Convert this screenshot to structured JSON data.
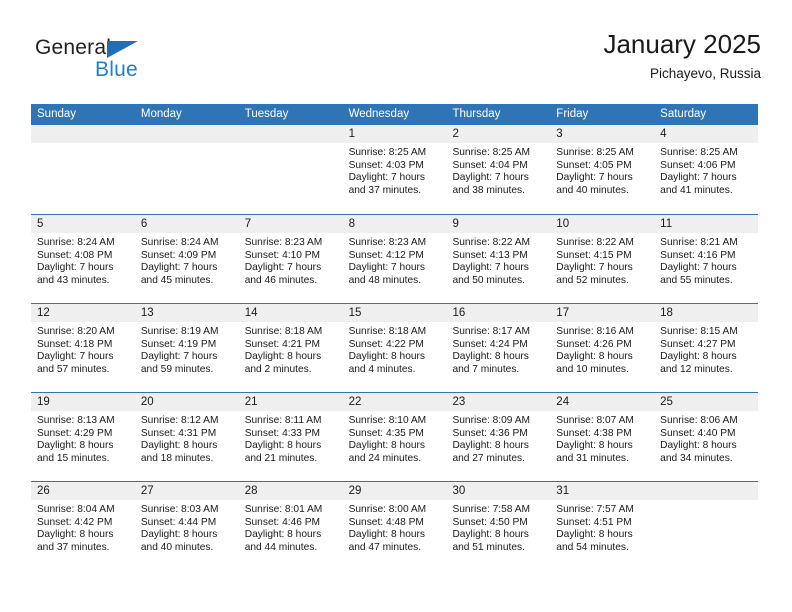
{
  "brand": {
    "name_part1": "General",
    "name_part2": "Blue",
    "triangle_color": "#1f6fb6",
    "blue_text_color": "#1f7fd0"
  },
  "header": {
    "title": "January 2025",
    "subtitle": "Pichayevo, Russia",
    "header_bg_color": "#2f75b5",
    "day_band_color": "#efefef"
  },
  "weekdays": [
    "Sunday",
    "Monday",
    "Tuesday",
    "Wednesday",
    "Thursday",
    "Friday",
    "Saturday"
  ],
  "weeks": [
    [
      {
        "day": "",
        "sunrise": "",
        "sunset": "",
        "daylight_line1": "",
        "daylight_line2": ""
      },
      {
        "day": "",
        "sunrise": "",
        "sunset": "",
        "daylight_line1": "",
        "daylight_line2": ""
      },
      {
        "day": "",
        "sunrise": "",
        "sunset": "",
        "daylight_line1": "",
        "daylight_line2": ""
      },
      {
        "day": "1",
        "sunrise": "Sunrise: 8:25 AM",
        "sunset": "Sunset: 4:03 PM",
        "daylight_line1": "Daylight: 7 hours",
        "daylight_line2": "and 37 minutes."
      },
      {
        "day": "2",
        "sunrise": "Sunrise: 8:25 AM",
        "sunset": "Sunset: 4:04 PM",
        "daylight_line1": "Daylight: 7 hours",
        "daylight_line2": "and 38 minutes."
      },
      {
        "day": "3",
        "sunrise": "Sunrise: 8:25 AM",
        "sunset": "Sunset: 4:05 PM",
        "daylight_line1": "Daylight: 7 hours",
        "daylight_line2": "and 40 minutes."
      },
      {
        "day": "4",
        "sunrise": "Sunrise: 8:25 AM",
        "sunset": "Sunset: 4:06 PM",
        "daylight_line1": "Daylight: 7 hours",
        "daylight_line2": "and 41 minutes."
      }
    ],
    [
      {
        "day": "5",
        "sunrise": "Sunrise: 8:24 AM",
        "sunset": "Sunset: 4:08 PM",
        "daylight_line1": "Daylight: 7 hours",
        "daylight_line2": "and 43 minutes."
      },
      {
        "day": "6",
        "sunrise": "Sunrise: 8:24 AM",
        "sunset": "Sunset: 4:09 PM",
        "daylight_line1": "Daylight: 7 hours",
        "daylight_line2": "and 45 minutes."
      },
      {
        "day": "7",
        "sunrise": "Sunrise: 8:23 AM",
        "sunset": "Sunset: 4:10 PM",
        "daylight_line1": "Daylight: 7 hours",
        "daylight_line2": "and 46 minutes."
      },
      {
        "day": "8",
        "sunrise": "Sunrise: 8:23 AM",
        "sunset": "Sunset: 4:12 PM",
        "daylight_line1": "Daylight: 7 hours",
        "daylight_line2": "and 48 minutes."
      },
      {
        "day": "9",
        "sunrise": "Sunrise: 8:22 AM",
        "sunset": "Sunset: 4:13 PM",
        "daylight_line1": "Daylight: 7 hours",
        "daylight_line2": "and 50 minutes."
      },
      {
        "day": "10",
        "sunrise": "Sunrise: 8:22 AM",
        "sunset": "Sunset: 4:15 PM",
        "daylight_line1": "Daylight: 7 hours",
        "daylight_line2": "and 52 minutes."
      },
      {
        "day": "11",
        "sunrise": "Sunrise: 8:21 AM",
        "sunset": "Sunset: 4:16 PM",
        "daylight_line1": "Daylight: 7 hours",
        "daylight_line2": "and 55 minutes."
      }
    ],
    [
      {
        "day": "12",
        "sunrise": "Sunrise: 8:20 AM",
        "sunset": "Sunset: 4:18 PM",
        "daylight_line1": "Daylight: 7 hours",
        "daylight_line2": "and 57 minutes."
      },
      {
        "day": "13",
        "sunrise": "Sunrise: 8:19 AM",
        "sunset": "Sunset: 4:19 PM",
        "daylight_line1": "Daylight: 7 hours",
        "daylight_line2": "and 59 minutes."
      },
      {
        "day": "14",
        "sunrise": "Sunrise: 8:18 AM",
        "sunset": "Sunset: 4:21 PM",
        "daylight_line1": "Daylight: 8 hours",
        "daylight_line2": "and 2 minutes."
      },
      {
        "day": "15",
        "sunrise": "Sunrise: 8:18 AM",
        "sunset": "Sunset: 4:22 PM",
        "daylight_line1": "Daylight: 8 hours",
        "daylight_line2": "and 4 minutes."
      },
      {
        "day": "16",
        "sunrise": "Sunrise: 8:17 AM",
        "sunset": "Sunset: 4:24 PM",
        "daylight_line1": "Daylight: 8 hours",
        "daylight_line2": "and 7 minutes."
      },
      {
        "day": "17",
        "sunrise": "Sunrise: 8:16 AM",
        "sunset": "Sunset: 4:26 PM",
        "daylight_line1": "Daylight: 8 hours",
        "daylight_line2": "and 10 minutes."
      },
      {
        "day": "18",
        "sunrise": "Sunrise: 8:15 AM",
        "sunset": "Sunset: 4:27 PM",
        "daylight_line1": "Daylight: 8 hours",
        "daylight_line2": "and 12 minutes."
      }
    ],
    [
      {
        "day": "19",
        "sunrise": "Sunrise: 8:13 AM",
        "sunset": "Sunset: 4:29 PM",
        "daylight_line1": "Daylight: 8 hours",
        "daylight_line2": "and 15 minutes."
      },
      {
        "day": "20",
        "sunrise": "Sunrise: 8:12 AM",
        "sunset": "Sunset: 4:31 PM",
        "daylight_line1": "Daylight: 8 hours",
        "daylight_line2": "and 18 minutes."
      },
      {
        "day": "21",
        "sunrise": "Sunrise: 8:11 AM",
        "sunset": "Sunset: 4:33 PM",
        "daylight_line1": "Daylight: 8 hours",
        "daylight_line2": "and 21 minutes."
      },
      {
        "day": "22",
        "sunrise": "Sunrise: 8:10 AM",
        "sunset": "Sunset: 4:35 PM",
        "daylight_line1": "Daylight: 8 hours",
        "daylight_line2": "and 24 minutes."
      },
      {
        "day": "23",
        "sunrise": "Sunrise: 8:09 AM",
        "sunset": "Sunset: 4:36 PM",
        "daylight_line1": "Daylight: 8 hours",
        "daylight_line2": "and 27 minutes."
      },
      {
        "day": "24",
        "sunrise": "Sunrise: 8:07 AM",
        "sunset": "Sunset: 4:38 PM",
        "daylight_line1": "Daylight: 8 hours",
        "daylight_line2": "and 31 minutes."
      },
      {
        "day": "25",
        "sunrise": "Sunrise: 8:06 AM",
        "sunset": "Sunset: 4:40 PM",
        "daylight_line1": "Daylight: 8 hours",
        "daylight_line2": "and 34 minutes."
      }
    ],
    [
      {
        "day": "26",
        "sunrise": "Sunrise: 8:04 AM",
        "sunset": "Sunset: 4:42 PM",
        "daylight_line1": "Daylight: 8 hours",
        "daylight_line2": "and 37 minutes."
      },
      {
        "day": "27",
        "sunrise": "Sunrise: 8:03 AM",
        "sunset": "Sunset: 4:44 PM",
        "daylight_line1": "Daylight: 8 hours",
        "daylight_line2": "and 40 minutes."
      },
      {
        "day": "28",
        "sunrise": "Sunrise: 8:01 AM",
        "sunset": "Sunset: 4:46 PM",
        "daylight_line1": "Daylight: 8 hours",
        "daylight_line2": "and 44 minutes."
      },
      {
        "day": "29",
        "sunrise": "Sunrise: 8:00 AM",
        "sunset": "Sunset: 4:48 PM",
        "daylight_line1": "Daylight: 8 hours",
        "daylight_line2": "and 47 minutes."
      },
      {
        "day": "30",
        "sunrise": "Sunrise: 7:58 AM",
        "sunset": "Sunset: 4:50 PM",
        "daylight_line1": "Daylight: 8 hours",
        "daylight_line2": "and 51 minutes."
      },
      {
        "day": "31",
        "sunrise": "Sunrise: 7:57 AM",
        "sunset": "Sunset: 4:51 PM",
        "daylight_line1": "Daylight: 8 hours",
        "daylight_line2": "and 54 minutes."
      },
      {
        "day": "",
        "sunrise": "",
        "sunset": "",
        "daylight_line1": "",
        "daylight_line2": ""
      }
    ]
  ]
}
